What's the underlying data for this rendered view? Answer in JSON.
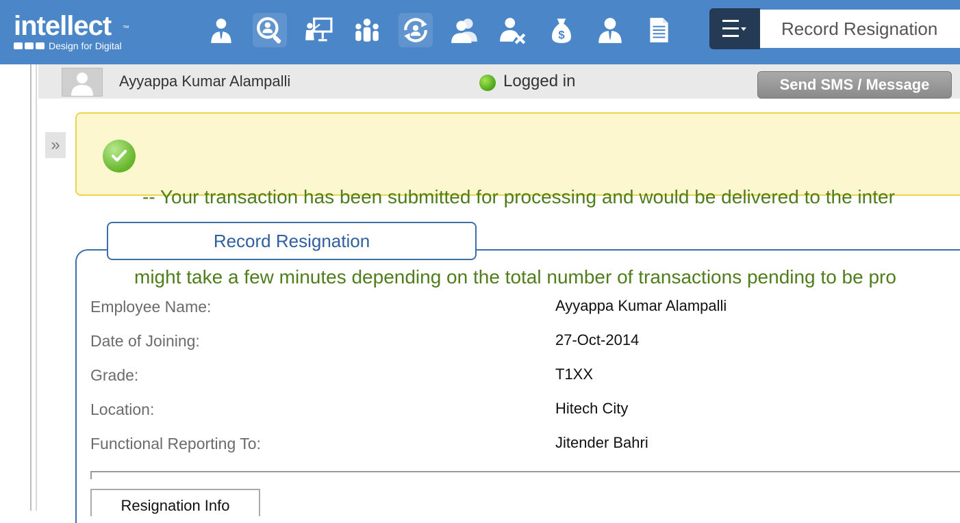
{
  "header": {
    "logo": {
      "word": "intellect",
      "tm": "™",
      "tagline": "Design for Digital"
    },
    "nav_icons": [
      "employee-tie-icon",
      "search-person-icon",
      "presentation-icon",
      "team-icon",
      "person-refresh-icon",
      "users-icon",
      "person-settings-icon",
      "money-bag-icon",
      "manager-icon",
      "document-icon"
    ],
    "active_nav": "search-person-icon",
    "record_title": "Record Resignation"
  },
  "userbar": {
    "name": "Ayyappa Kumar Alampalli",
    "status": "Logged in",
    "sms_button": "Send SMS / Message"
  },
  "notice": {
    "line1": "-- Your transaction has been submitted for processing and would be delivered to the inter",
    "line2": "might take a few minutes depending on the total number of transactions pending to be pro"
  },
  "section": {
    "title": "Record Resignation",
    "fields": [
      {
        "label": "Employee Name:",
        "value": "Ayyappa Kumar Alampalli"
      },
      {
        "label": "Date of Joining:",
        "value": "27-Oct-2014"
      },
      {
        "label": "Grade:",
        "value": "T1XX"
      },
      {
        "label": "Location:",
        "value": "Hitech City"
      },
      {
        "label": "Functional Reporting To:",
        "value": "Jitender Bahri"
      }
    ],
    "tab_label": "Resignation Info"
  },
  "colors": {
    "topbar": "#4a86c8",
    "menu_button": "#253b55",
    "notice_bg": "#fcf7cf",
    "notice_text": "#4f7d1c",
    "section_border": "#3c6ea8"
  }
}
